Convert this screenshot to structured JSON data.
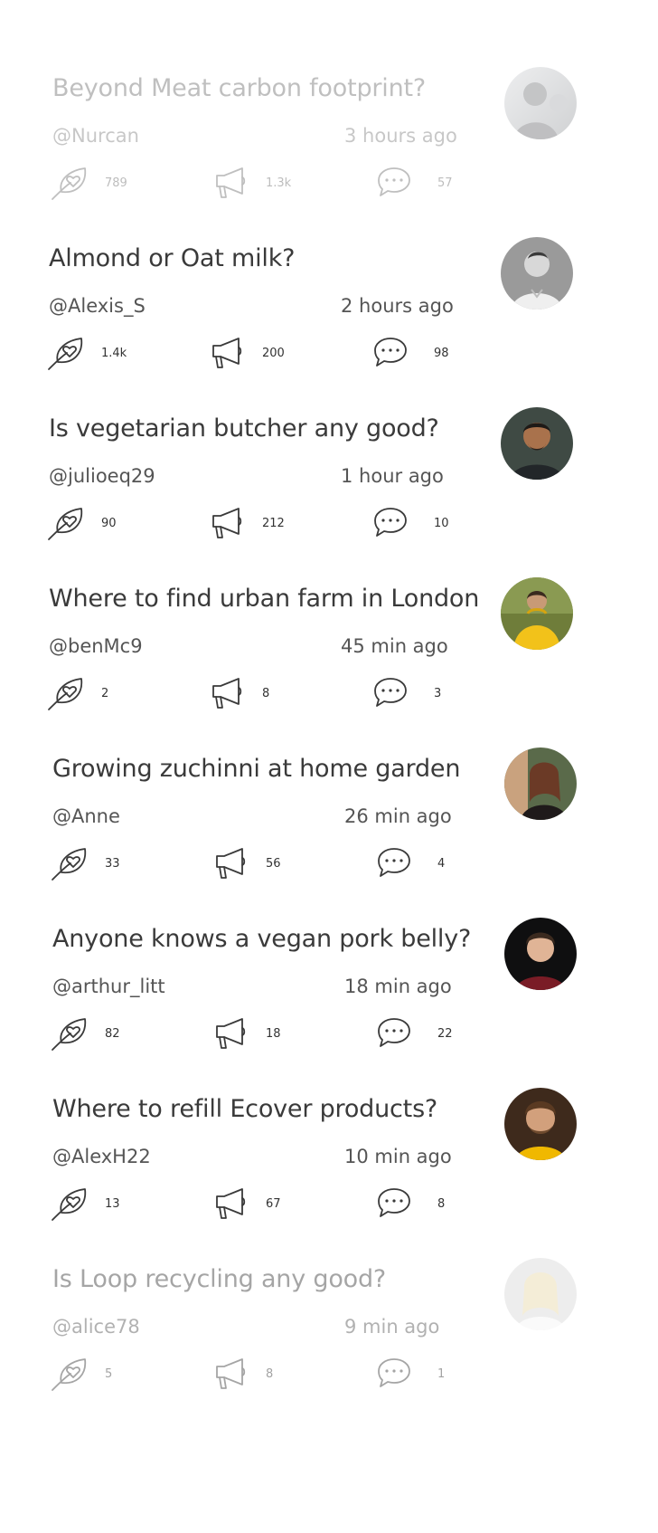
{
  "posts": [
    {
      "title": "Beyond Meat carbon footprint?",
      "user": "@Nurcan",
      "time": "3 hours ago",
      "likes": "789",
      "shares": "1.3k",
      "comments": "57",
      "avatar_icon": "avatar-photo-nurcan"
    },
    {
      "title": "Almond or Oat milk?",
      "user": "@Alexis_S",
      "time": "2 hours ago",
      "likes": "1.4k",
      "shares": "200",
      "comments": "98",
      "avatar_icon": "avatar-photo-alexis"
    },
    {
      "title": "Is vegetarian butcher any good?",
      "user": "@julioeq29",
      "time": "1 hour ago",
      "likes": "90",
      "shares": "212",
      "comments": "10",
      "avatar_icon": "avatar-photo-julio"
    },
    {
      "title": "Where to find urban farm in London",
      "user": "@benMc9",
      "time": "45 min ago",
      "likes": "2",
      "shares": "8",
      "comments": "3",
      "avatar_icon": "avatar-photo-ben"
    },
    {
      "title": "Growing zuchinni at home garden",
      "user": "@Anne",
      "time": "26 min ago",
      "likes": "33",
      "shares": "56",
      "comments": "4",
      "avatar_icon": "avatar-photo-anne"
    },
    {
      "title": "Anyone knows a vegan pork belly?",
      "user": "@arthur_litt",
      "time": "18 min ago",
      "likes": "82",
      "shares": "18",
      "comments": "22",
      "avatar_icon": "avatar-photo-arthur"
    },
    {
      "title": "Where to refill Ecover products?",
      "user": "@AlexH22",
      "time": "10 min ago",
      "likes": "13",
      "shares": "67",
      "comments": "8",
      "avatar_icon": "avatar-photo-alexh"
    },
    {
      "title": "Is Loop recycling any good?",
      "user": "@alice78",
      "time": "9 min ago",
      "likes": "5",
      "shares": "8",
      "comments": "1",
      "avatar_icon": "avatar-photo-alice"
    }
  ],
  "icons": {
    "like": "leaf-heart-icon",
    "share": "megaphone-icon",
    "comment": "speech-bubble-icon"
  }
}
